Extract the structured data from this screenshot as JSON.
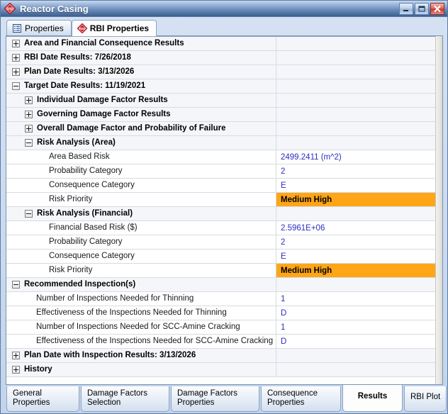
{
  "window": {
    "title": "Reactor Casing",
    "icon": "rbi-diamond-icon",
    "controls": [
      {
        "name": "minimize-button",
        "glyph": "_"
      },
      {
        "name": "maximize-button",
        "glyph": "□"
      },
      {
        "name": "close-button",
        "glyph": "✕"
      }
    ]
  },
  "top_tabs": [
    {
      "label": "Properties",
      "icon": "list-properties-icon",
      "active": false
    },
    {
      "label": "RBI Properties",
      "icon": "rbi-diamond-icon",
      "active": true
    }
  ],
  "grid": {
    "rows": [
      {
        "type": "group",
        "indent": 0,
        "expanded": false,
        "label": "Area and Financial Consequence Results",
        "value": ""
      },
      {
        "type": "group",
        "indent": 0,
        "expanded": false,
        "label": "RBI Date Results: 7/26/2018",
        "value": ""
      },
      {
        "type": "group",
        "indent": 0,
        "expanded": false,
        "label": "Plan Date Results: 3/13/2026",
        "value": ""
      },
      {
        "type": "group",
        "indent": 0,
        "expanded": true,
        "label": "Target Date Results: 11/19/2021",
        "value": ""
      },
      {
        "type": "group",
        "indent": 1,
        "expanded": false,
        "label": "Individual Damage Factor Results",
        "value": ""
      },
      {
        "type": "group",
        "indent": 1,
        "expanded": false,
        "label": "Governing Damage Factor Results",
        "value": ""
      },
      {
        "type": "group",
        "indent": 1,
        "expanded": false,
        "label": "Overall Damage Factor and Probability of Failure",
        "value": ""
      },
      {
        "type": "group",
        "indent": 1,
        "expanded": true,
        "label": "Risk Analysis (Area)",
        "value": ""
      },
      {
        "type": "leaf",
        "indent": 2,
        "label": "Area Based Risk",
        "value": "2499.2411 (m^2)",
        "highlight": false
      },
      {
        "type": "leaf",
        "indent": 2,
        "label": "Probability Category",
        "value": "2",
        "highlight": false
      },
      {
        "type": "leaf",
        "indent": 2,
        "label": "Consequence Category",
        "value": "E",
        "highlight": false
      },
      {
        "type": "leaf",
        "indent": 2,
        "label": "Risk Priority",
        "value": "Medium High",
        "highlight": true
      },
      {
        "type": "group",
        "indent": 1,
        "expanded": true,
        "label": "Risk Analysis (Financial)",
        "value": ""
      },
      {
        "type": "leaf",
        "indent": 2,
        "label": "Financial Based Risk ($)",
        "value": "2.5961E+06",
        "highlight": false
      },
      {
        "type": "leaf",
        "indent": 2,
        "label": "Probability Category",
        "value": "2",
        "highlight": false
      },
      {
        "type": "leaf",
        "indent": 2,
        "label": "Consequence Category",
        "value": "E",
        "highlight": false
      },
      {
        "type": "leaf",
        "indent": 2,
        "label": "Risk Priority",
        "value": "Medium High",
        "highlight": true
      },
      {
        "type": "group",
        "indent": 0,
        "expanded": true,
        "label": "Recommended Inspection(s)",
        "value": ""
      },
      {
        "type": "leaf",
        "indent": 1,
        "label": "Number of Inspections Needed for Thinning",
        "value": "1",
        "highlight": false
      },
      {
        "type": "leaf",
        "indent": 1,
        "label": "Effectiveness of the Inspections Needed for Thinning",
        "value": "D",
        "highlight": false
      },
      {
        "type": "leaf",
        "indent": 1,
        "label": "Number of Inspections Needed for SCC-Amine Cracking",
        "value": "1",
        "highlight": false
      },
      {
        "type": "leaf",
        "indent": 1,
        "label": "Effectiveness of the Inspections Needed for SCC-Amine Cracking",
        "value": "D",
        "highlight": false
      },
      {
        "type": "group",
        "indent": 0,
        "expanded": false,
        "label": "Plan Date with Inspection Results: 3/13/2026",
        "value": ""
      },
      {
        "type": "group",
        "indent": 0,
        "expanded": false,
        "label": "History",
        "value": ""
      }
    ]
  },
  "bottom_tabs": [
    {
      "label": "General\nProperties",
      "active": false,
      "key": "general-properties"
    },
    {
      "label": "Damage Factors\nSelection",
      "active": false,
      "key": "damage-factors-selection"
    },
    {
      "label": "Damage Factors\nProperties",
      "active": false,
      "key": "damage-factors-properties"
    },
    {
      "label": "Consequence\nProperties",
      "active": false,
      "key": "consequence-properties"
    },
    {
      "label": "Results",
      "active": true,
      "key": "results"
    },
    {
      "label": "RBI Plot",
      "active": false,
      "key": "rbi-plot"
    }
  ],
  "colors": {
    "highlight": "#FFA617",
    "value_text": "#2C2CC4",
    "title_bar": "#3C5F90"
  }
}
